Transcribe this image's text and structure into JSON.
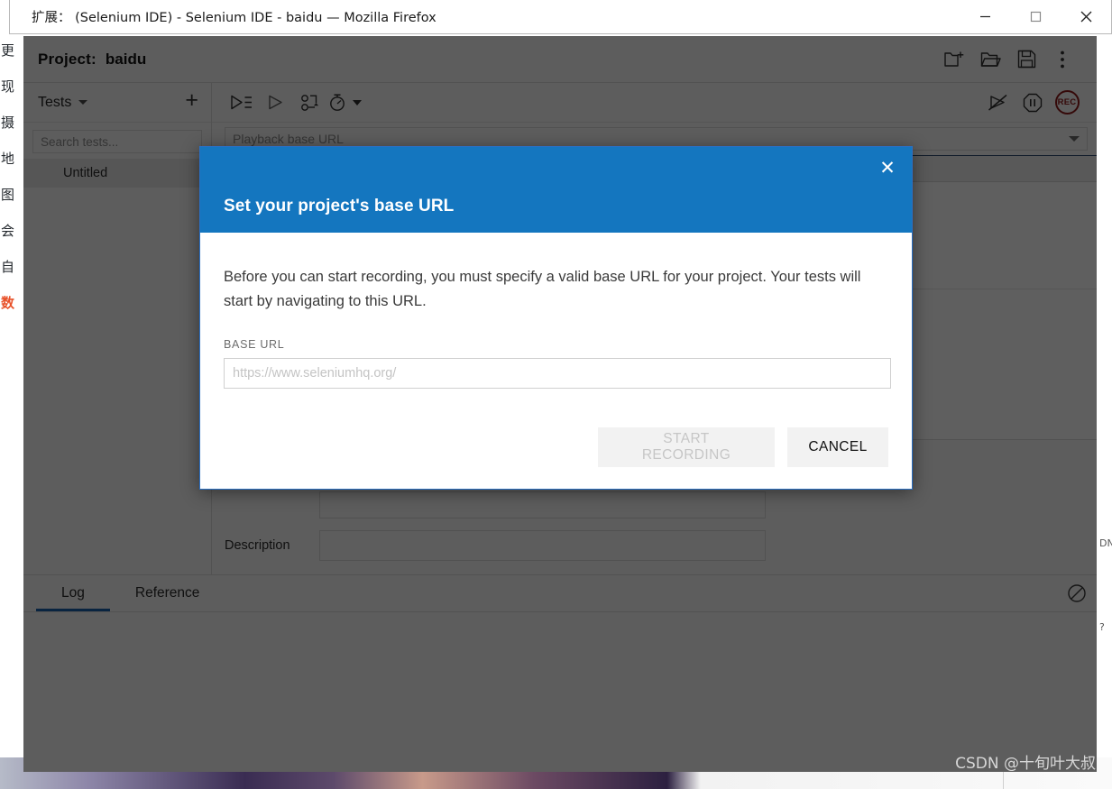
{
  "window": {
    "title": "扩展： (Selenium IDE) - Selenium IDE - baidu — Mozilla Firefox",
    "minimize_label": "—",
    "maximize_label": "□",
    "close_label": "✕"
  },
  "ide": {
    "header": {
      "project_label": "Project:",
      "project_name": "baidu",
      "icons": [
        {
          "name": "new-project-icon",
          "glyph": "new-folder"
        },
        {
          "name": "open-project-icon",
          "glyph": "folder"
        },
        {
          "name": "save-project-icon",
          "glyph": "floppy"
        },
        {
          "name": "more-options-icon",
          "glyph": "kebab"
        }
      ]
    },
    "sidebar": {
      "tests_label": "Tests",
      "add_test_label": "+",
      "search_placeholder": "Search tests...",
      "tests": [
        {
          "label": "Untitled"
        }
      ]
    },
    "playback_toolbar": {
      "run_all_tests_label": "Run all tests",
      "run_current_test_label": "Run current test",
      "step_over_label": "Step over",
      "speed_label": "Test execution speed",
      "disable_breakpoints_label": "Disable breakpoints",
      "pause_label": "Pause",
      "record_label": "REC"
    },
    "playback_url_placeholder": "Playback base URL",
    "detail": {
      "description_label": "Description",
      "description_value": ""
    },
    "log_tabs": [
      {
        "label": "Log",
        "active": true
      },
      {
        "label": "Reference",
        "active": false
      }
    ],
    "log_clear_label": "Clear log"
  },
  "modal": {
    "title": "Set your project's base URL",
    "close_label": "✕",
    "body_text": "Before you can start recording, you must specify a valid base URL for your project. Your tests will start by navigating to this URL.",
    "field_label": "BASE URL",
    "input_value": "",
    "input_placeholder": "https://www.seleniumhq.org/",
    "start_recording_label": "START RECORDING",
    "cancel_label": "CANCEL",
    "header_color": "#1476bf",
    "border_color": "#2a6fc4"
  },
  "background_page": {
    "left_fragments": [
      "更",
      "现",
      "摄",
      "地",
      "图",
      "会",
      "自",
      "数"
    ],
    "right_fragments": [
      "DN",
      "?"
    ]
  },
  "watermark": {
    "text": "CSDN @十旬叶大叔"
  }
}
